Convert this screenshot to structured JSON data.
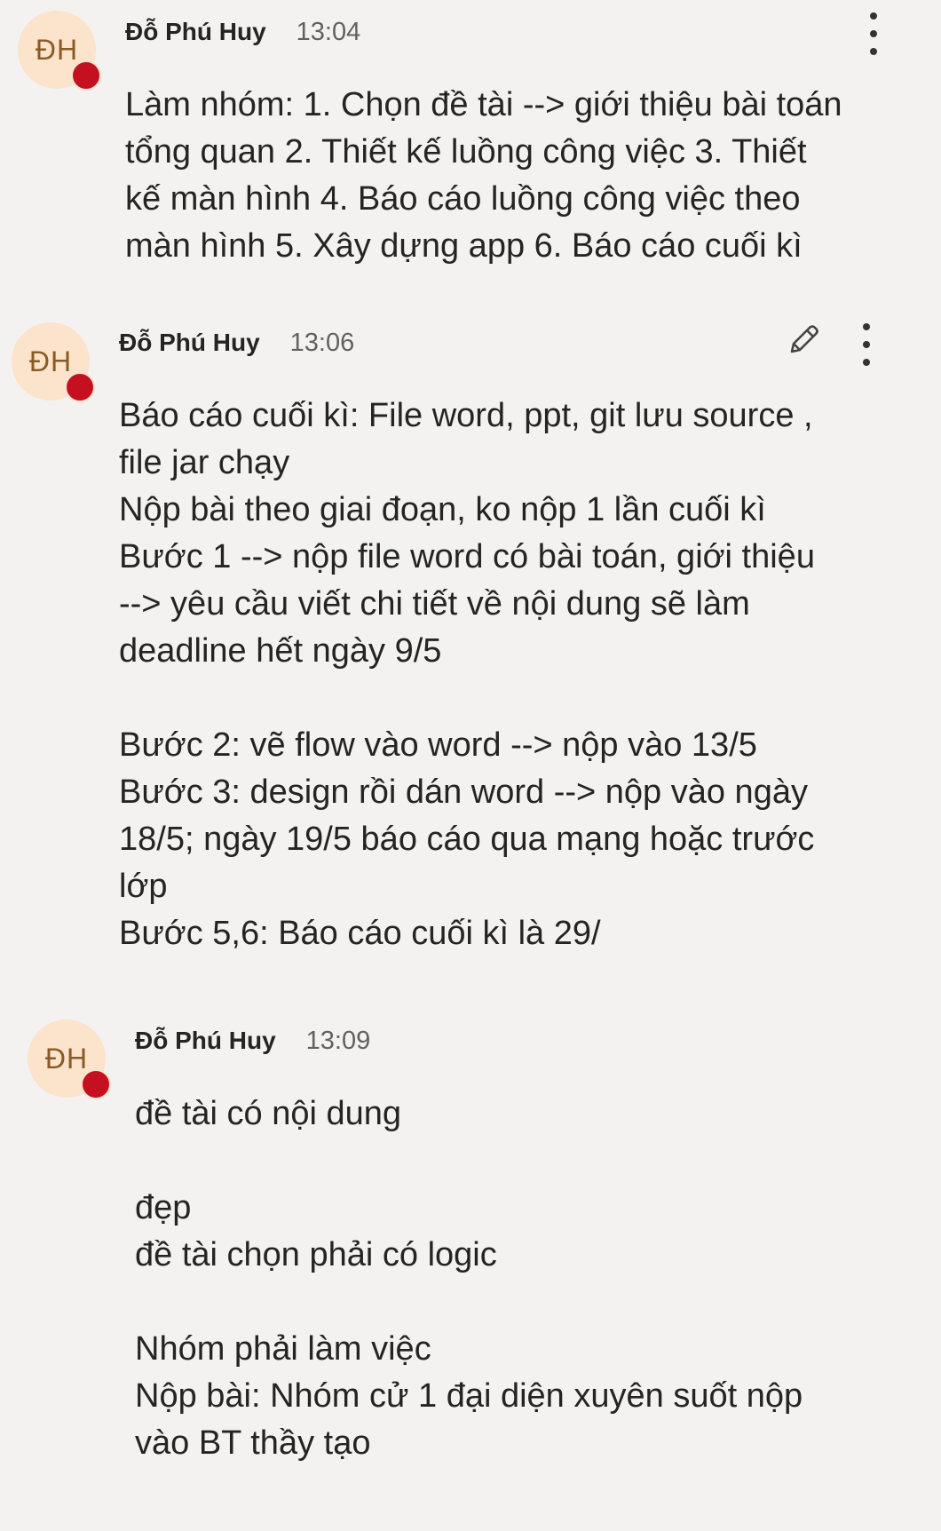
{
  "colors": {
    "background": "#f3f2f1",
    "avatar_bg": "#fbe3cc",
    "avatar_text": "#8a5a22",
    "presence_dot": "#c4101f"
  },
  "messages": [
    {
      "avatar_initials": "ĐH",
      "author": "Đỗ Phú Huy",
      "time": "13:04",
      "lines": [
        "Làm nhóm: 1. Chọn đề tài --> giới thiệu bài toán",
        "tổng quan 2. Thiết kế luồng công việc 3. Thiết",
        "kế màn hình 4. Báo cáo luồng công việc theo",
        "màn hình 5. Xây dựng app 6. Báo cáo cuối kì"
      ],
      "actions": [
        "more-options-icon"
      ]
    },
    {
      "avatar_initials": "ĐH",
      "author": "Đỗ Phú Huy",
      "time": "13:06",
      "lines": [
        "Báo cáo cuối kì: File word, ppt, git lưu source ,",
        "file jar chạy",
        "Nộp bài theo giai đoạn, ko nộp 1 lần cuối kì",
        "Bước 1 --> nộp file word có bài toán, giới thiệu",
        "--> yêu cầu viết chi tiết về nội dung sẽ làm",
        "deadline hết ngày 9/5",
        "",
        "Bước 2: vẽ flow vào word --> nộp vào 13/5",
        "Bước 3: design rồi dán word --> nộp vào ngày",
        "18/5; ngày 19/5 báo cáo qua mạng hoặc trước",
        "lớp",
        "Bước 5,6: Báo cáo cuối kì là 29/"
      ],
      "actions": [
        "edit-pencil-icon",
        "more-options-icon"
      ]
    },
    {
      "avatar_initials": "ĐH",
      "author": "Đỗ Phú Huy",
      "time": "13:09",
      "lines": [
        "đề tài có nội dung",
        "",
        "đẹp",
        "đề tài chọn phải có logic",
        "",
        "Nhóm phải làm việc",
        "Nộp bài: Nhóm cử 1 đại diện xuyên suốt nộp",
        "vào BT thầy tạo"
      ],
      "actions": []
    }
  ]
}
